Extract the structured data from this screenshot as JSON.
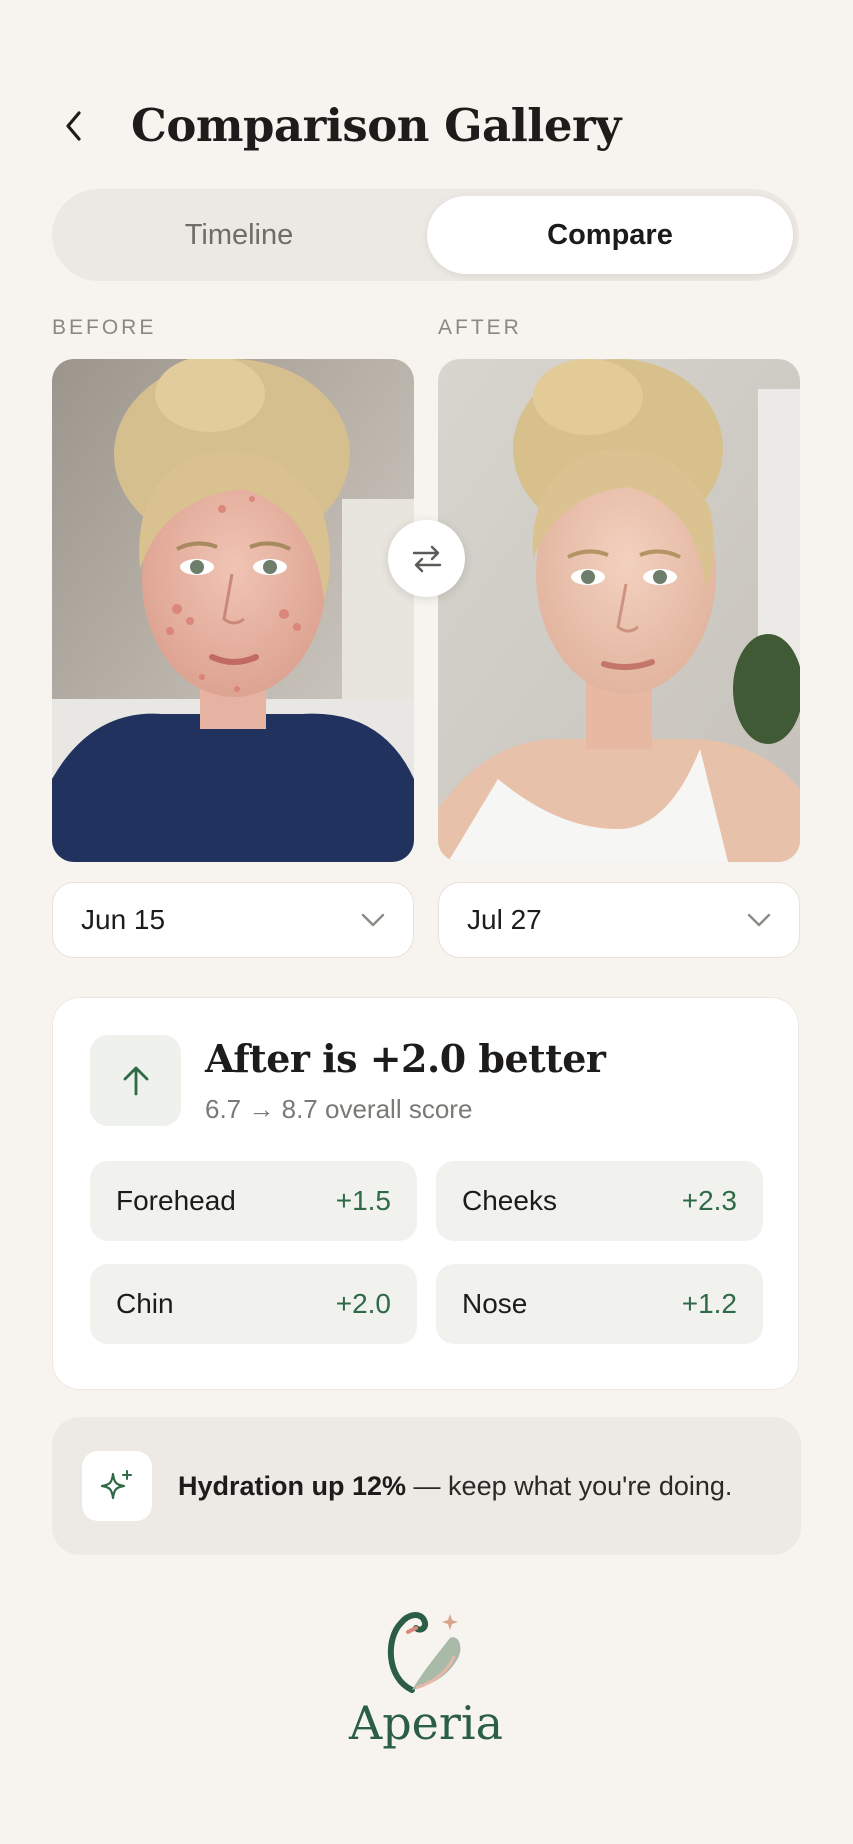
{
  "header": {
    "title": "Comparison Gallery",
    "back_icon": "chevron-left-icon"
  },
  "segmented": {
    "tabs": [
      "Timeline",
      "Compare"
    ],
    "active": "Compare"
  },
  "before": {
    "label": "BEFORE",
    "date": "Jun 15"
  },
  "after": {
    "label": "AFTER",
    "date": "Jul 27"
  },
  "swap_icon": "swap-arrows-icon",
  "score": {
    "title": "After is +2.0 better",
    "from": "6.7",
    "arrow": "→",
    "to": "8.7",
    "caption": "overall score",
    "icon": "arrow-up-icon",
    "regions": [
      {
        "name": "Forehead",
        "delta": "+1.5"
      },
      {
        "name": "Cheeks",
        "delta": "+2.3"
      },
      {
        "name": "Chin",
        "delta": "+2.0"
      },
      {
        "name": "Nose",
        "delta": "+1.2"
      }
    ]
  },
  "tip": {
    "highlight": "Hydration up 12%",
    "rest": " — keep what you're doing.",
    "icon": "sparkle-icon"
  },
  "brand": {
    "name": "Aperia"
  },
  "colors": {
    "accent": "#2f6a47",
    "background": "#f7f4f0",
    "card": "#ffffff"
  }
}
